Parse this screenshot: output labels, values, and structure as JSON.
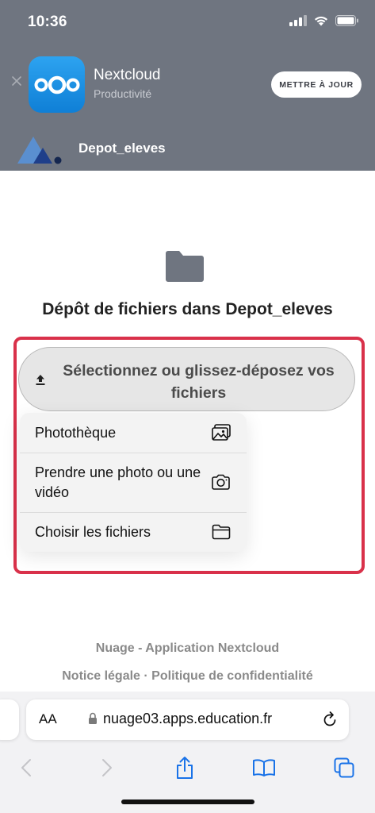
{
  "status": {
    "time": "10:36"
  },
  "app_banner": {
    "name": "Nextcloud",
    "category": "Productivité",
    "update_label": "METTRE À JOUR"
  },
  "site": {
    "title": "Depot_eleves"
  },
  "main": {
    "title": "Dépôt de fichiers dans Depot_eleves",
    "upload_label": "Sélectionnez ou glissez-déposez vos fichiers"
  },
  "menu": {
    "items": [
      {
        "label": "Photothèque",
        "icon": "photo-library-icon"
      },
      {
        "label": "Prendre une photo ou une vidéo",
        "icon": "camera-icon"
      },
      {
        "label": "Choisir les fichiers",
        "icon": "folder-icon"
      }
    ]
  },
  "footer": {
    "line1": "Nuage - Application Nextcloud",
    "legal": "Notice légale",
    "separator": "·",
    "privacy": "Politique de confidentialité"
  },
  "browser": {
    "aa_label": "AA",
    "url": "nuage03.apps.education.fr"
  },
  "colors": {
    "header_gray": "#6f7580",
    "highlight_red": "#d9314a",
    "safari_blue": "#1a73e8"
  }
}
